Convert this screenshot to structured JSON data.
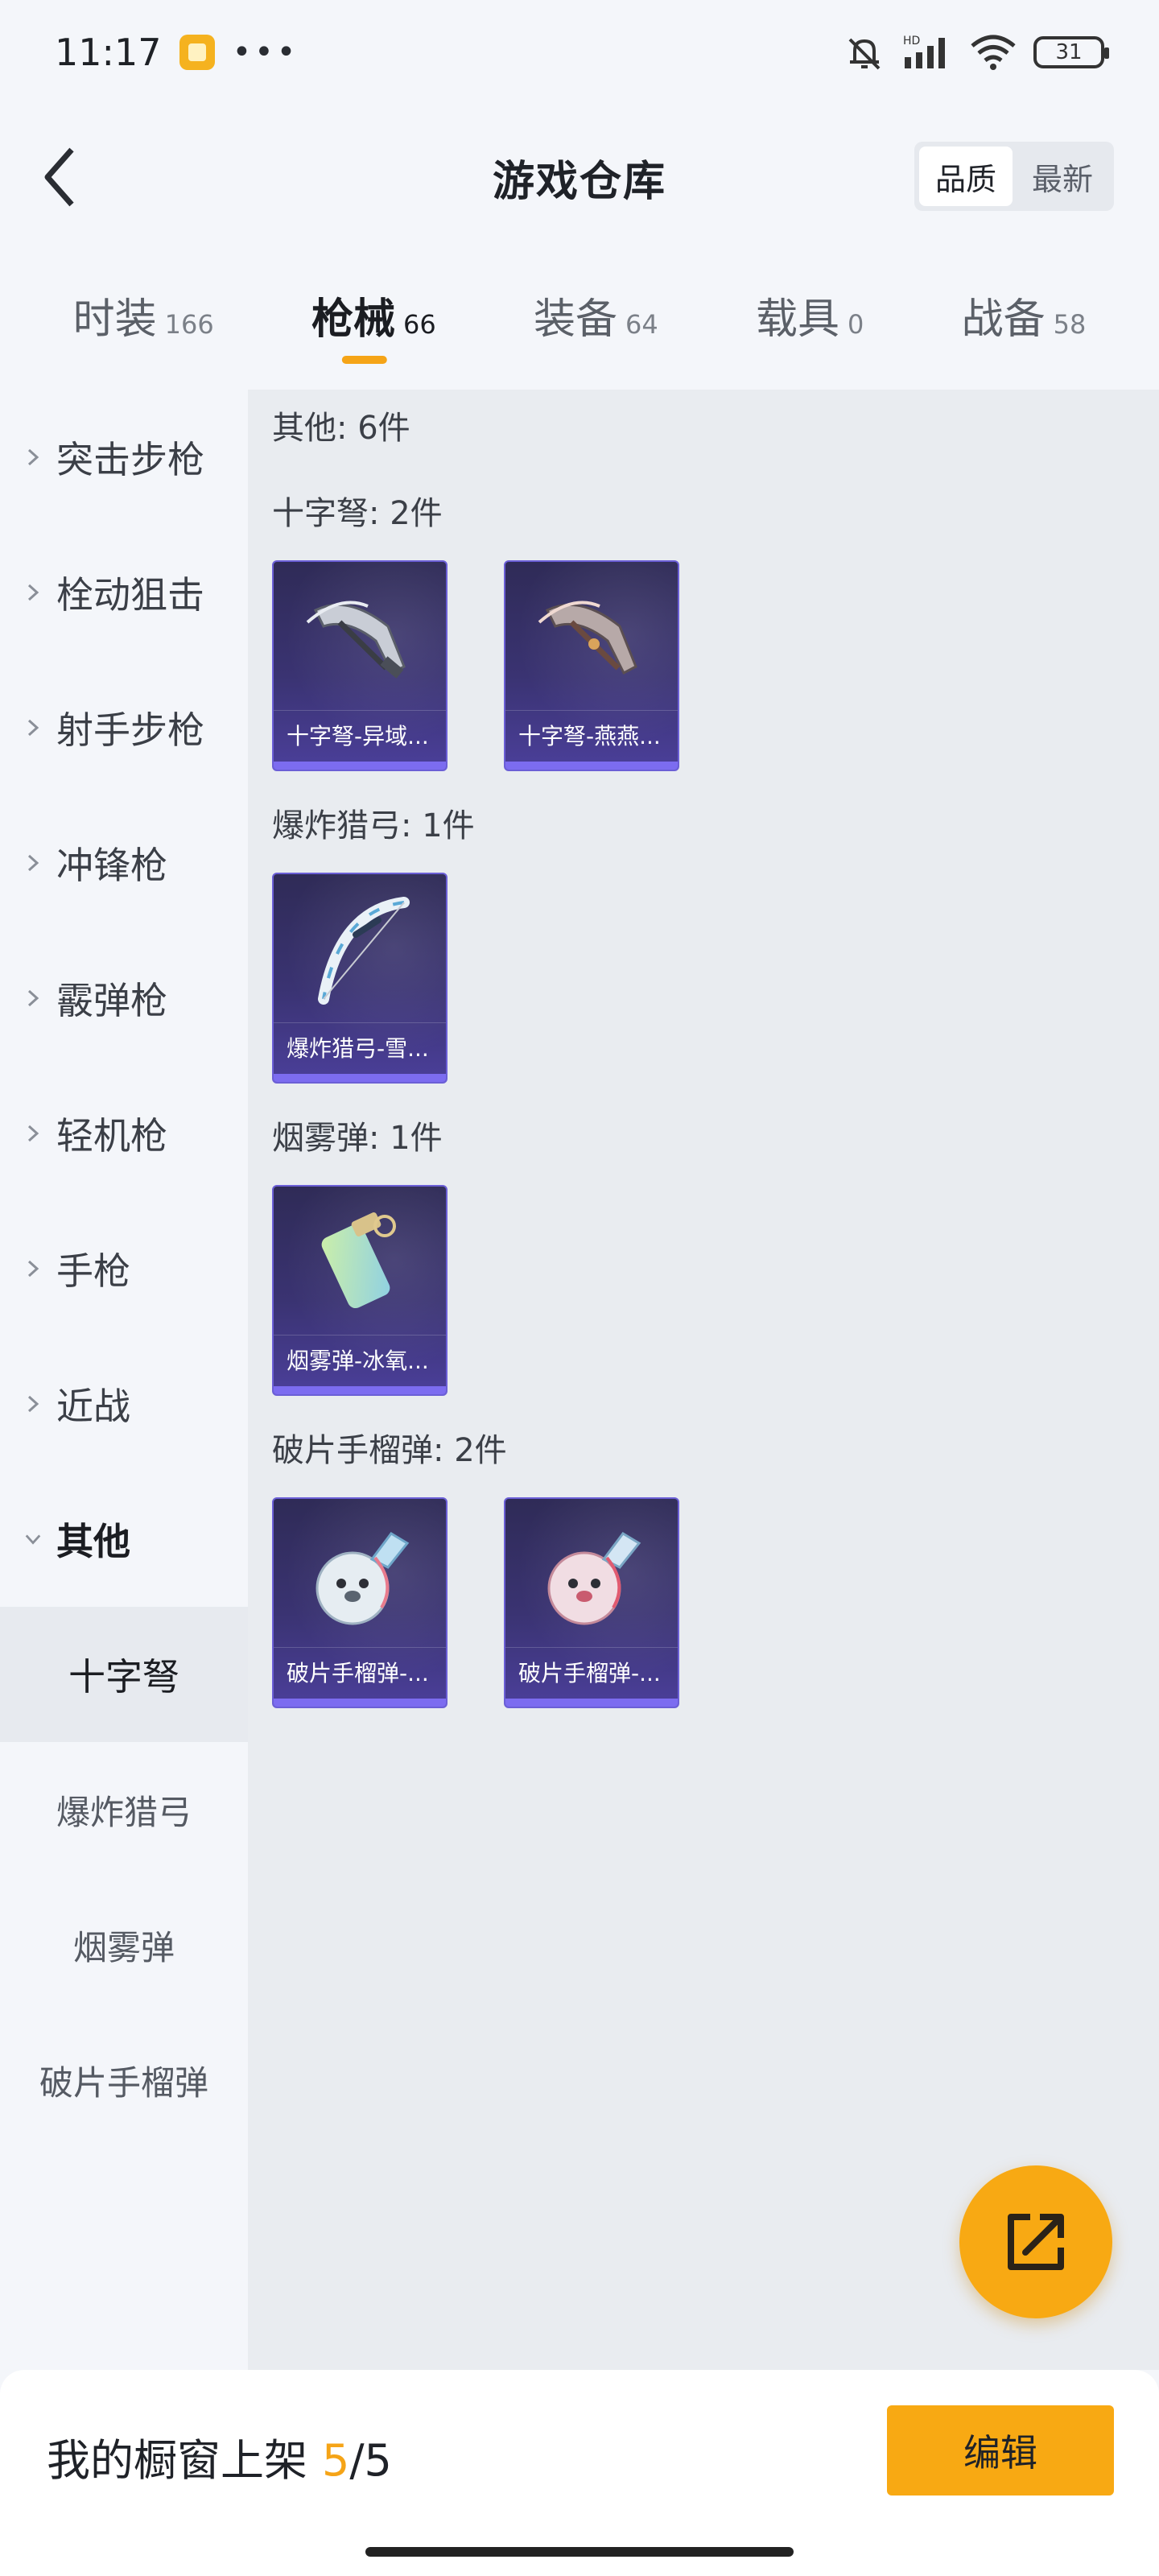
{
  "status_bar": {
    "time": "11:17",
    "dots": "•••",
    "battery": "31"
  },
  "header": {
    "title": "游戏仓库",
    "sort_options": [
      {
        "label": "品质",
        "active": true
      },
      {
        "label": "最新",
        "active": false
      }
    ]
  },
  "tabs": [
    {
      "label": "时装",
      "count": "166",
      "active": false
    },
    {
      "label": "枪械",
      "count": "66",
      "active": true
    },
    {
      "label": "装备",
      "count": "64",
      "active": false
    },
    {
      "label": "载具",
      "count": "0",
      "active": false
    },
    {
      "label": "战备",
      "count": "58",
      "active": false
    }
  ],
  "sidebar": {
    "categories": [
      {
        "label": "突击步枪"
      },
      {
        "label": "栓动狙击"
      },
      {
        "label": "射手步枪"
      },
      {
        "label": "冲锋枪"
      },
      {
        "label": "霰弹枪"
      },
      {
        "label": "轻机枪"
      },
      {
        "label": "手枪"
      },
      {
        "label": "近战"
      },
      {
        "label": "其他",
        "expanded": true
      }
    ],
    "sub_items": [
      {
        "label": "十字弩",
        "active": true
      },
      {
        "label": "爆炸猎弓",
        "active": false
      },
      {
        "label": "烟雾弹",
        "active": false
      },
      {
        "label": "破片手榴弹",
        "active": false
      }
    ]
  },
  "content": {
    "summary": "其他: 6件",
    "groups": [
      {
        "title": "十字弩: 2件",
        "items": [
          {
            "name": "十字弩-异域...",
            "icon": "crossbow-icon"
          },
          {
            "name": "十字弩-燕燕...",
            "icon": "crossbow-icon"
          }
        ]
      },
      {
        "title": "爆炸猎弓: 1件",
        "items": [
          {
            "name": "爆炸猎弓-雪...",
            "icon": "bow-icon"
          }
        ]
      },
      {
        "title": "烟雾弹: 1件",
        "items": [
          {
            "name": "烟雾弹-冰氧...",
            "icon": "smoke-grenade-icon"
          }
        ]
      },
      {
        "title": "破片手榴弹: 2件",
        "items": [
          {
            "name": "破片手榴弹-...",
            "icon": "grenade-icon"
          },
          {
            "name": "破片手榴弹-...",
            "icon": "grenade-icon"
          }
        ]
      }
    ]
  },
  "bottom_bar": {
    "shelf_label": "我的橱窗上架",
    "shelf_count": "5",
    "shelf_total": "/5",
    "edit_label": "编辑"
  },
  "colors": {
    "accent": "#f8a913",
    "card_bg": "#3a3372",
    "card_bar": "#7c6cf0"
  }
}
